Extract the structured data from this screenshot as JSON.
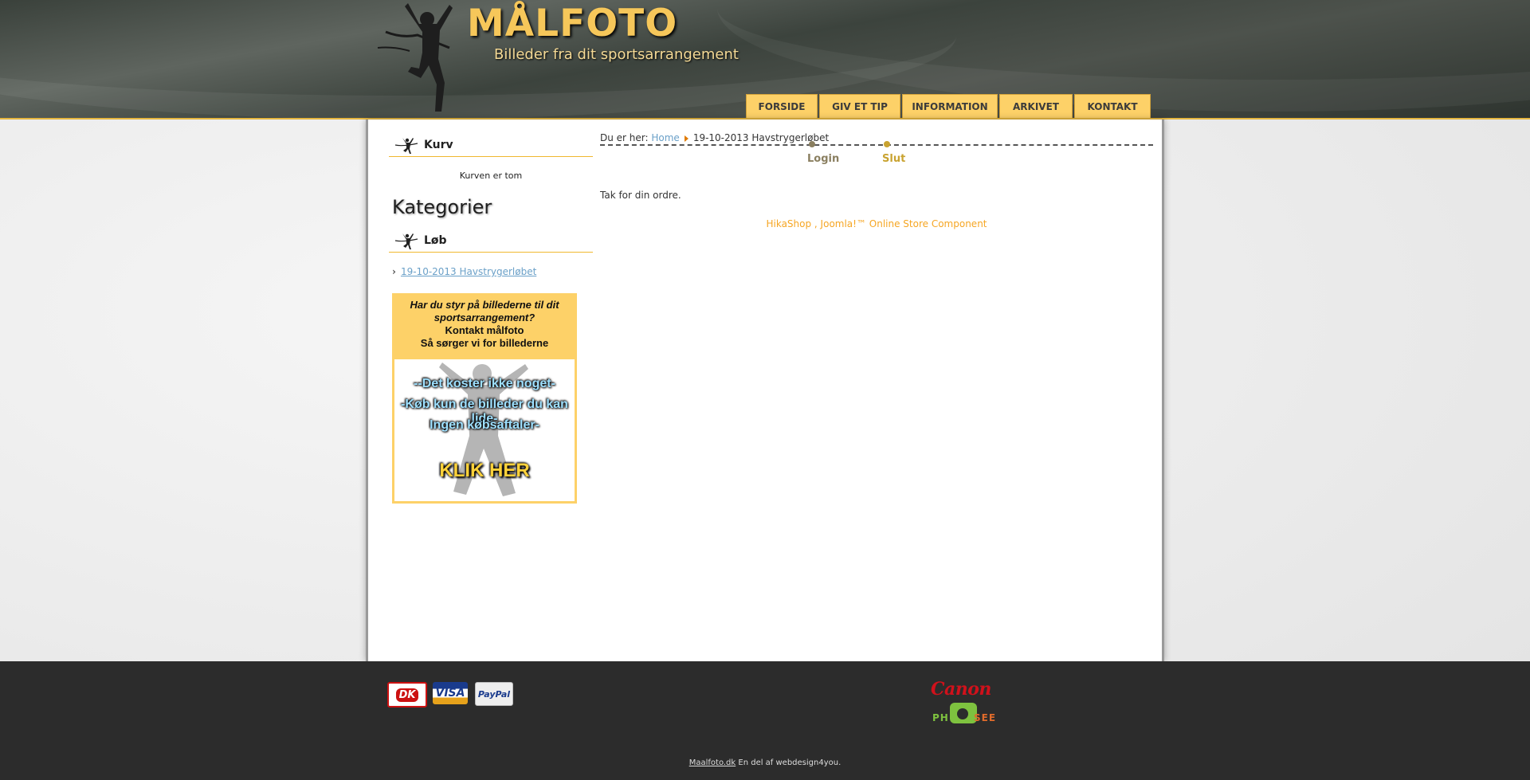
{
  "header": {
    "title": "MÅLFOTO",
    "tagline": "Billeder fra dit sportsarrangement"
  },
  "nav": [
    {
      "label": "FORSIDE",
      "name": "nav-forside"
    },
    {
      "label": "GIV ET TIP",
      "name": "nav-giv-et-tip"
    },
    {
      "label": "INFORMATION",
      "name": "nav-information"
    },
    {
      "label": "ARKIVET",
      "name": "nav-arkivet"
    },
    {
      "label": "KONTAKT",
      "name": "nav-kontakt"
    }
  ],
  "sidebar": {
    "cart_title": "Kurv",
    "cart_empty": "Kurven er tom",
    "categories_heading": "Kategorier",
    "race_title": "Løb",
    "race_link": "19-10-2013 Havstrygerløbet",
    "promo": {
      "question": "Har du styr på billederne til dit sportsarrangement?",
      "contact_line1": "Kontakt målfoto",
      "contact_line2": "Så sørger vi for billederne",
      "line1": "--Det koster ikke noget-",
      "line2": "-Køb kun de billeder du kan lide-",
      "line3": "Ingen købsaftaler-",
      "cta": "KLIK HER"
    }
  },
  "content": {
    "breadcrumb_prefix": "Du er her:",
    "breadcrumb_home": "Home",
    "breadcrumb_current": "19-10-2013 Havstrygerløbet",
    "steps": [
      {
        "label": "Login",
        "color": "#8a7f60"
      },
      {
        "label": "Slut",
        "color": "#c9a331"
      }
    ],
    "thanks": "Tak for din ordre.",
    "powered": "HikaShop , Joomla!™ Online Store Component"
  },
  "footer": {
    "pay_dk": "DK",
    "pay_visa": "VISA",
    "pay_paypal": "PayPal",
    "canon": "Canon",
    "phosee_a": "PH",
    "phosee_b": "SEE",
    "credit_link": "Maalfoto.dk",
    "credit_text": " En del af webdesign4you."
  },
  "colors": {
    "accent": "#fdd168",
    "header_border": "#e5b640",
    "link": "#6aa0c8",
    "powered": "#f6a623"
  }
}
